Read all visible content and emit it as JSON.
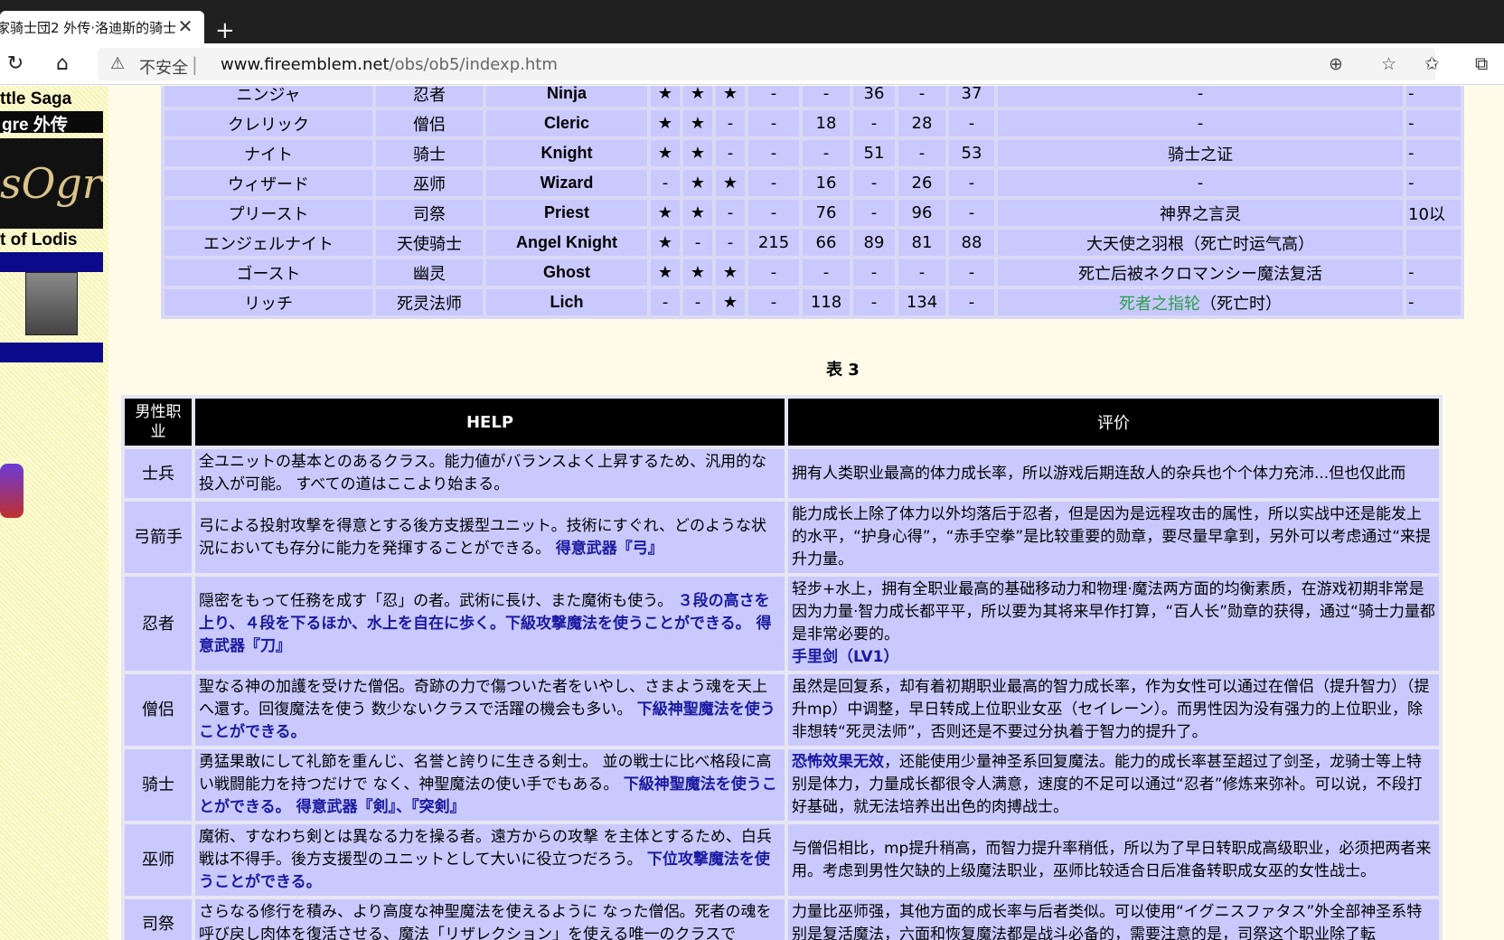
{
  "browser": {
    "tab_title": "家骑士団2 外传·洛迪斯的骑士",
    "tab_close": "✕",
    "new_tab": "+",
    "insecure_label": "不安全",
    "separator": "|",
    "url_host": "www.fireemblem.net",
    "url_path": "/obs/ob5/indexp.htm"
  },
  "sidebar": {
    "line1": "ttle Saga",
    "line2": "gre 外传",
    "logo_text": "sOgre外伝",
    "line3": "t of Lodis"
  },
  "table1": {
    "rows": [
      {
        "jp": "ニンジャ",
        "cn": "忍者",
        "en": "Ninja",
        "s1": "★",
        "s2": "★",
        "s3": "★",
        "c1": "-",
        "c2": "-",
        "c3": "36",
        "c4": "-",
        "c5": "37",
        "note": "-",
        "tail": "-"
      },
      {
        "jp": "クレリック",
        "cn": "僧侣",
        "en": "Cleric",
        "s1": "★",
        "s2": "★",
        "s3": "-",
        "c1": "-",
        "c2": "18",
        "c3": "-",
        "c4": "28",
        "c5": "-",
        "note": "-",
        "tail": "-"
      },
      {
        "jp": "ナイト",
        "cn": "骑士",
        "en": "Knight",
        "s1": "★",
        "s2": "★",
        "s3": "-",
        "c1": "-",
        "c2": "-",
        "c3": "51",
        "c4": "-",
        "c5": "53",
        "note": "骑士之证",
        "tail": "-"
      },
      {
        "jp": "ウィザード",
        "cn": "巫师",
        "en": "Wizard",
        "s1": "-",
        "s2": "★",
        "s3": "★",
        "c1": "-",
        "c2": "16",
        "c3": "-",
        "c4": "26",
        "c5": "-",
        "note": "-",
        "tail": "-"
      },
      {
        "jp": "プリースト",
        "cn": "司祭",
        "en": "Priest",
        "s1": "★",
        "s2": "★",
        "s3": "-",
        "c1": "-",
        "c2": "76",
        "c3": "-",
        "c4": "96",
        "c5": "-",
        "note": "神界之言灵",
        "tail": "10以"
      },
      {
        "jp": "エンジェルナイト",
        "cn": "天使骑士",
        "en": "Angel Knight",
        "s1": "★",
        "s2": "-",
        "s3": "-",
        "c1": "215",
        "c2": "66",
        "c3": "89",
        "c4": "81",
        "c5": "88",
        "note": "大天使之羽根（死亡时运气高）",
        "tail": ""
      },
      {
        "jp": "ゴースト",
        "cn": "幽灵",
        "en": "Ghost",
        "s1": "★",
        "s2": "★",
        "s3": "★",
        "c1": "-",
        "c2": "-",
        "c3": "-",
        "c4": "-",
        "c5": "-",
        "note": "死亡后被ネクロマンシー魔法复活",
        "tail": "-"
      },
      {
        "jp": "リッチ",
        "cn": "死灵法师",
        "en": "Lich",
        "s1": "-",
        "s2": "-",
        "s3": "★",
        "c1": "-",
        "c2": "118",
        "c3": "-",
        "c4": "134",
        "c5": "-",
        "note_green": "死者之指轮",
        "note": "（死亡时）",
        "tail": "-"
      }
    ]
  },
  "caption": "表 3",
  "table2": {
    "headers": {
      "job": "男性职业",
      "help": "HELP",
      "eval": "评价"
    },
    "rows": [
      {
        "job": "士兵",
        "help": "全ユニットの基本とのあるクラス。能力値がバランスよく上昇するため、汎用的な投入が可能。 すべての道はここより始まる。",
        "help_bold": "",
        "eval": "拥有人类职业最高的体力成长率，所以游戏后期连敌人的杂兵也个个体力充沛...但也仅此而",
        "eval_bold": ""
      },
      {
        "job": "弓箭手",
        "help": "弓による投射攻撃を得意とする後方支援型ユニット。技術にすぐれ、どのような状況においても存分に能力を発揮することができる。",
        "help_bold": "得意武器『弓』",
        "eval": "能力成长上除了体力以外均落后于忍者，但是因为是远程攻击的属性，所以实战中还是能发上的水平，“护身心得”，“赤手空拳”是比较重要的勋章，要尽量早拿到，另外可以考虑通过“来提升力量。",
        "eval_bold": ""
      },
      {
        "job": "忍者",
        "help": "隠密をもって任務を成す「忍」の者。武術に長け、また魔術も使う。",
        "help_bold": "３段の高さを上り、４段を下るほか、水上を自在に歩く。下級攻撃魔法を使うことができる。 得意武器『刀』",
        "eval": "轻步+水上，拥有全职业最高的基础移动力和物理·魔法两方面的均衡素质，在游戏初期非常是因为力量·智力成长都平平，所以要为其将来早作打算，“百人长”勋章的获得，通过“骑士力量都是非常必要的。",
        "eval_bold": "手里剑（LV1）"
      },
      {
        "job": "僧侣",
        "help": "聖なる神の加護を受けた僧侶。奇跡の力で傷ついた者をいやし、さまよう魂を天上へ還す。回復魔法を使う 数少ないクラスで活躍の機会も多い。",
        "help_bold": "下級神聖魔法を使うことができる。",
        "eval": "虽然是回复系，却有着初期职业最高的智力成长率，作为女性可以通过在僧侣（提升智力）（提升mp）中调整，早日转成上位职业女巫（セイレーン）。而男性因为没有强力的上位职业，除非想转“死灵法师”，否则还是不要过分执着于智力的提升了。",
        "eval_bold": ""
      },
      {
        "job": "骑士",
        "help": "勇猛果敢にして礼節を重んじ、名誉と誇りに生きる剣士。 並の戦士に比べ格段に高い戦闘能力を持つだけで なく、神聖魔法の使い手でもある。",
        "help_bold": "下級神聖魔法を使うことができる。 得意武器『剣』、『突剣』",
        "eval": "，还能使用少量神圣系回复魔法。能力的成长率甚至超过了剑圣，龙骑士等上特别是体力，力量成长都很令人满意，速度的不足可以通过“忍者”修炼来弥补。可以说，不段打好基础，就无法培养出出色的肉搏战士。",
        "eval_bold": "恐怖效果无效"
      },
      {
        "job": "巫师",
        "help": "魔術、すなわち剣とは異なる力を操る者。遠方からの攻撃 を主体とするため、白兵戦は不得手。後方支援型のユニットとして大いに役立つだろう。",
        "help_bold": "下位攻撃魔法を使うことができる。",
        "eval": "与僧侣相比，mp提升稍高，而智力提升率稍低，所以为了早日转职成高级职业，必须把两者来用。考虑到男性欠缺的上级魔法职业，巫师比较适合日后准备转职成女巫的女性战士。",
        "eval_bold": ""
      },
      {
        "job": "司祭",
        "help": "さらなる修行を積み、より高度な神聖魔法を使えるように なった僧侶。死者の魂を呼び戻し肉体を復活させる、魔法「リザレクション」を使える唯一のクラスで",
        "help_bold": "",
        "eval": "力量比巫师强，其他方面的成长率与后者类似。可以使用“イグニスファタス”外全部神圣系特别是复活魔法，六面和恢复魔法都是战斗必备的，需要注意的是，司祭这个职业除了転",
        "eval_bold": ""
      }
    ]
  }
}
